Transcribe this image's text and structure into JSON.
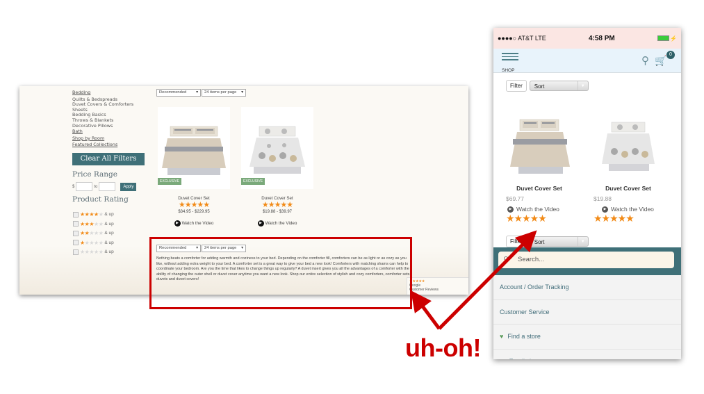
{
  "desktop": {
    "categories": {
      "main": "Bedding",
      "subs": [
        "Quilts & Bedspreads",
        "Duvet Covers & Comforters",
        "Sheets",
        "Bedding Basics",
        "Throws & Blankets",
        "Decorative Pillows"
      ],
      "links": [
        "Bath",
        "Shop by Room",
        "Featured Collections"
      ]
    },
    "clear_filters_label": "Clear All Filters",
    "price_range": {
      "title": "Price Range",
      "currency": "$",
      "to_label": "to",
      "min_value": "",
      "max_value": "",
      "apply_label": "Apply"
    },
    "product_rating": {
      "title": "Product Rating",
      "options": [
        {
          "stars": 4,
          "label": "& up"
        },
        {
          "stars": 3,
          "label": "& up"
        },
        {
          "stars": 2,
          "label": "& up"
        },
        {
          "stars": 1,
          "label": "& up"
        },
        {
          "stars": 0,
          "label": "& up"
        }
      ]
    },
    "sort_select": "Recommended",
    "per_page_select": "24 items per page",
    "products": [
      {
        "badge": "EXCLUSIVE",
        "name": "Duvet Cover Set",
        "rating": 5,
        "price": "$34.95 - $229.95",
        "video_label": "Watch the Video"
      },
      {
        "badge": "EXCLUSIVE",
        "name": "Duvet Cover Set",
        "rating": 5,
        "price": "$19.88 - $39.97",
        "video_label": "Watch the Video"
      }
    ],
    "description": "Nothing beats a comforter for adding warmth and coziness to your bed. Depending on the comforter fill, comforters can be as light or as cozy as you like, without adding extra weight to your bed. A comforter set is a great way to give your bed a new look! Comforters with matching shams can help to coordinate your bedroom. Are you the time that likes to change things up regularly? A duvet insert gives you all the advantages of a comforter with the ability of changing the outer shell or duvet cover anytime you want a new look. Shop our entire selection of stylish and cozy comforters, comforter sets, duvets and duvet covers!",
    "review_badge": {
      "stars": "★★★★★",
      "line1": "Google",
      "line2": "Customer Reviews"
    }
  },
  "mobile": {
    "status": {
      "carrier": "●●●●○ AT&T  LTE",
      "time": "4:58 PM"
    },
    "menu_label": "SHOP",
    "cart_count": "0",
    "filter_label": "Filter",
    "sort_label": "Sort",
    "products": [
      {
        "name": "Duvet Cover Set",
        "price": "$69.77",
        "video_label": "Watch the Video",
        "rating": 5
      },
      {
        "name": "Duvet Cover Set",
        "price": "$19.88",
        "video_label": "Watch the Video",
        "rating": 5
      }
    ],
    "drawer": {
      "search_placeholder": "Search...",
      "items": [
        "Account / Order Tracking",
        "Customer Service",
        "Find a store",
        "Email sign up"
      ]
    }
  },
  "annotation": {
    "text": "uh-oh!",
    "color": "#cc0000"
  }
}
